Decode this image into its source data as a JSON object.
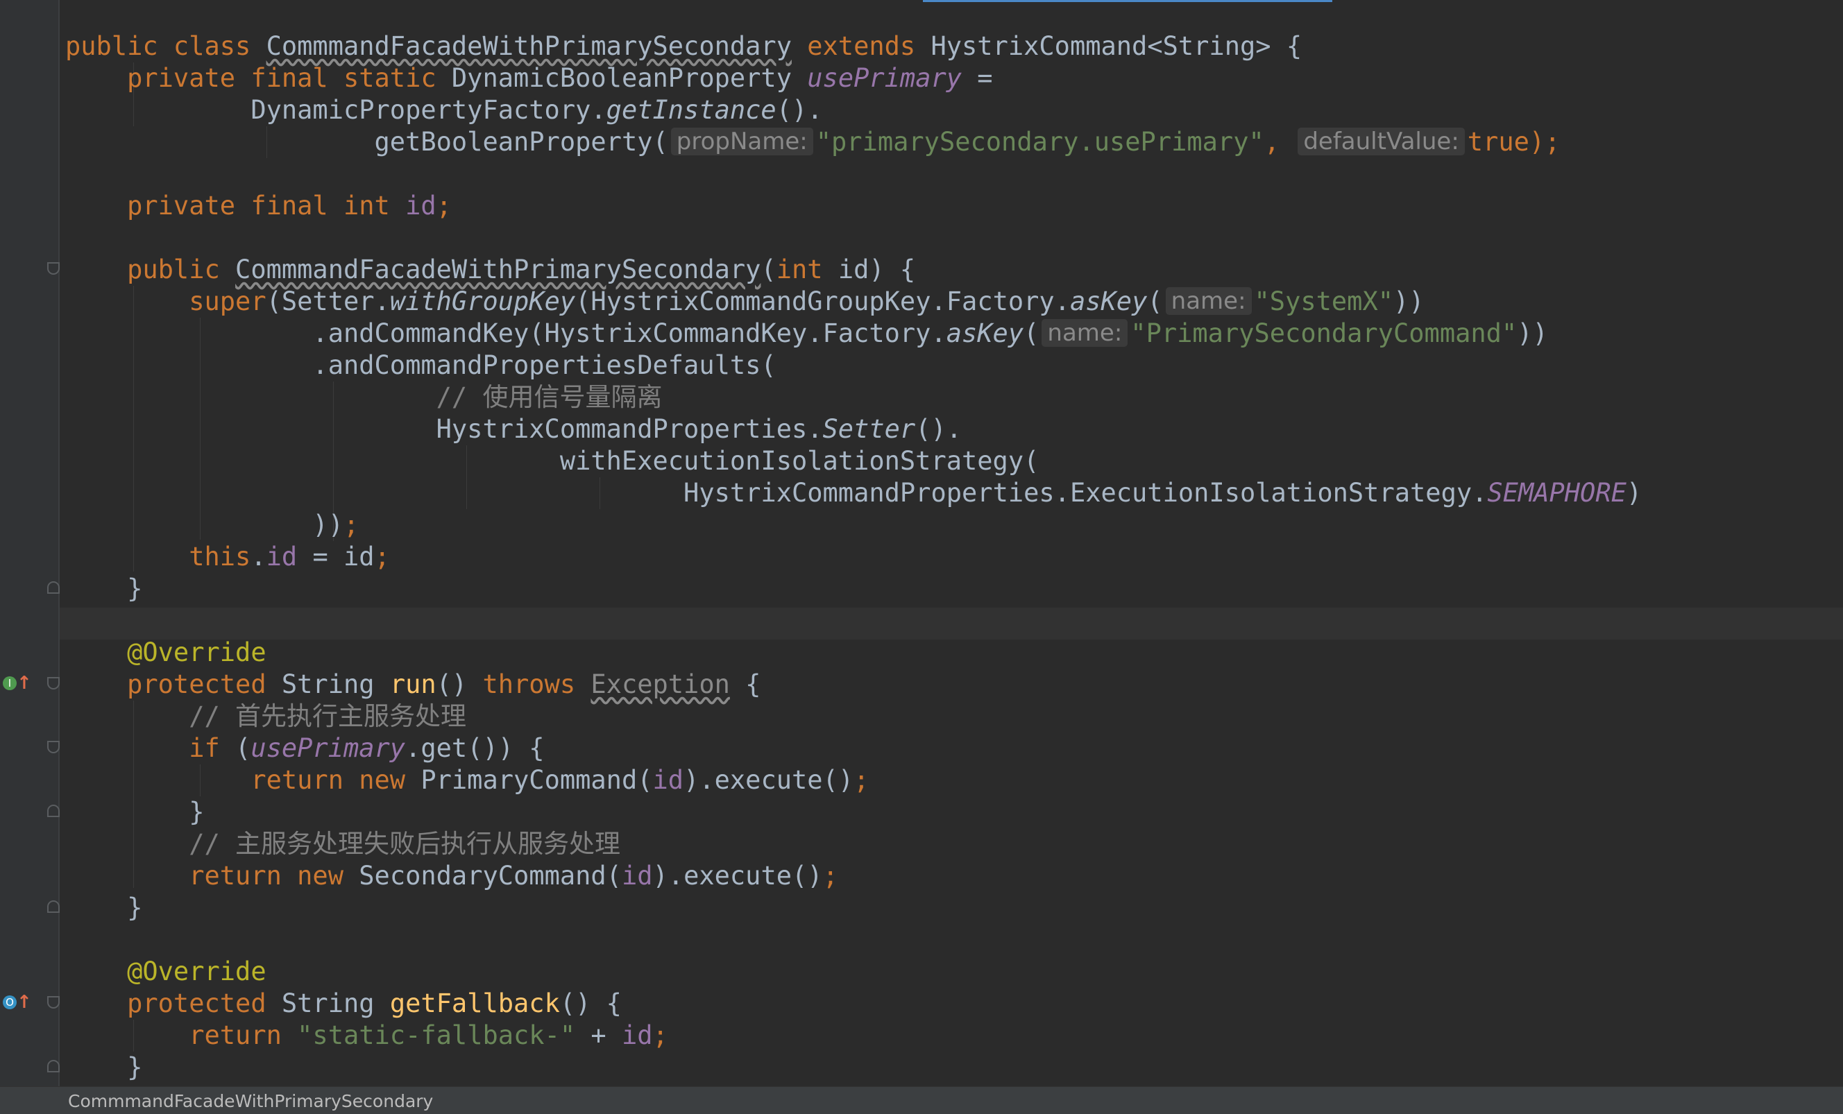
{
  "editor": {
    "breadcrumb": "CommmandFacadeWithPrimarySecondary",
    "colors": {
      "background": "#2b2b2b",
      "keyword": "#cc7832",
      "string": "#6a8759",
      "field": "#9876aa",
      "annotation": "#bbb529",
      "method": "#ffc66d",
      "comment": "#808080",
      "text": "#a9b7c6"
    },
    "gutter_icons": [
      "implements-method-icon",
      "overrides-method-icon"
    ],
    "code": {
      "l1": {
        "kw": "public class ",
        "classname": "CommmandFacadeWithPrimarySecondary",
        "kw2": " extends ",
        "rest": "HystrixCommand<String> {"
      },
      "l2": {
        "indent": "    ",
        "kw": "private final static ",
        "type": "DynamicBooleanProperty ",
        "field": "usePrimary",
        "rest": " ="
      },
      "l3": {
        "indent": "            ",
        "cls": "DynamicPropertyFactory.",
        "method": "getInstance",
        "rest": "()."
      },
      "l4": {
        "indent": "                    ",
        "call": "getBooleanProperty(",
        "hint1": "propName:",
        "str": "\"primarySecondary.usePrimary\"",
        "comma": ",",
        "hint2": "defaultValue:",
        "val": "true",
        "close": ");"
      },
      "l6": {
        "indent": "    ",
        "kw": "private final int ",
        "field": "id",
        "semi": ";"
      },
      "l8": {
        "indent": "    ",
        "kw": "public ",
        "ctor": "CommmandFacadeWithPrimarySecondary",
        "paren": "(",
        "kw2": "int ",
        "rest": "id) {"
      },
      "l9": {
        "indent": "        ",
        "kw": "super",
        "a": "(Setter.",
        "method": "withGroupKey",
        "b": "(HystrixCommandGroupKey.Factory.",
        "method2": "asKey",
        "c": "(",
        "hint": "name:",
        "str": "\"SystemX\"",
        "d": "))"
      },
      "l10": {
        "indent": "                ",
        "a": ".andCommandKey(HystrixCommandKey.Factory.",
        "method": "asKey",
        "b": "(",
        "hint": "name:",
        "str": "\"PrimarySecondaryCommand\"",
        "c": "))"
      },
      "l11": {
        "indent": "                ",
        "text": ".andCommandPropertiesDefaults("
      },
      "l12": {
        "indent": "                        ",
        "comment": "// 使用信号量隔离"
      },
      "l13": {
        "indent": "                        ",
        "a": "HystrixCommandProperties.",
        "method": "Setter",
        "b": "()."
      },
      "l14": {
        "indent": "                                ",
        "text": "withExecutionIsolationStrategy("
      },
      "l15": {
        "indent": "                                        ",
        "a": "HystrixCommandProperties.ExecutionIsolationStrategy.",
        "const": "SEMAPHORE",
        "b": ")"
      },
      "l16": {
        "indent": "                ",
        "a": "))",
        "semi": ";"
      },
      "l17": {
        "indent": "        ",
        "kw": "this",
        "dot": ".",
        "field": "id",
        "rest": " = id",
        "semi": ";"
      },
      "l18": {
        "indent": "    ",
        "text": "}"
      },
      "l20": {
        "indent": "    ",
        "ann": "@Override"
      },
      "l21": {
        "indent": "    ",
        "kw": "protected ",
        "type": "String ",
        "method": "run",
        "a": "() ",
        "kw2": "throws ",
        "exc": "Exception",
        "b": " {"
      },
      "l22": {
        "indent": "        ",
        "comment": "// 首先执行主服务处理"
      },
      "l23": {
        "indent": "        ",
        "kw": "if ",
        "a": "(",
        "field": "usePrimary",
        "b": ".get()) {"
      },
      "l24": {
        "indent": "            ",
        "kw": "return new ",
        "a": "PrimaryCommand(",
        "field": "id",
        "b": ").execute()",
        "semi": ";"
      },
      "l25": {
        "indent": "        ",
        "text": "}"
      },
      "l26": {
        "indent": "        ",
        "comment": "// 主服务处理失败后执行从服务处理"
      },
      "l27": {
        "indent": "        ",
        "kw": "return new ",
        "a": "SecondaryCommand(",
        "field": "id",
        "b": ").execute()",
        "semi": ";"
      },
      "l28": {
        "indent": "    ",
        "text": "}"
      },
      "l30": {
        "indent": "    ",
        "ann": "@Override"
      },
      "l31": {
        "indent": "    ",
        "kw": "protected ",
        "type": "String ",
        "method": "getFallback",
        "rest": "() {"
      },
      "l32": {
        "indent": "        ",
        "kw": "return ",
        "str": "\"static-fallback-\"",
        "plus": " + ",
        "field": "id",
        "semi": ";"
      },
      "l33": {
        "indent": "    ",
        "text": "}"
      }
    }
  }
}
